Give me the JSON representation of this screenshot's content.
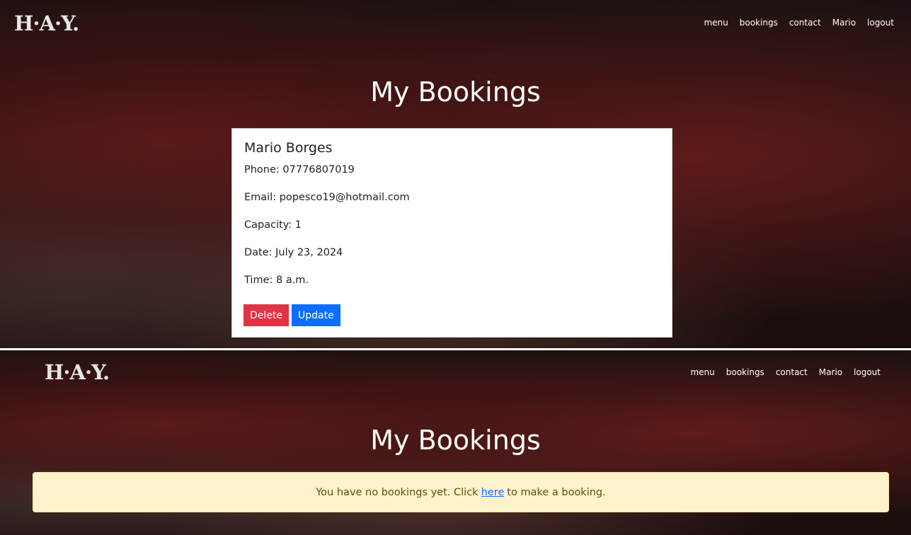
{
  "top": {
    "logo": "H·A·Y.",
    "nav": [
      "menu",
      "bookings",
      "contact",
      "Mario",
      "logout"
    ],
    "title": "My Bookings",
    "booking": {
      "name": "Mario Borges",
      "phone": "Phone: 07776807019",
      "email": "Email: popesco19@hotmail.com",
      "capacity": "Capacity: 1",
      "date": "Date: July 23, 2024",
      "time": "Time: 8 a.m.",
      "delete_label": "Delete",
      "update_label": "Update"
    }
  },
  "bottom": {
    "logo": "H·A·Y.",
    "nav": [
      "menu",
      "bookings",
      "contact",
      "Mario",
      "logout"
    ],
    "title": "My Bookings",
    "alert": {
      "text_before": "You have no bookings yet. Click",
      "link": "here",
      "text_after": "to make a booking."
    }
  },
  "colors": {
    "danger": "#dc3545",
    "primary": "#0d6efd",
    "alert_bg": "#fff3cd",
    "alert_text": "#664d03"
  }
}
